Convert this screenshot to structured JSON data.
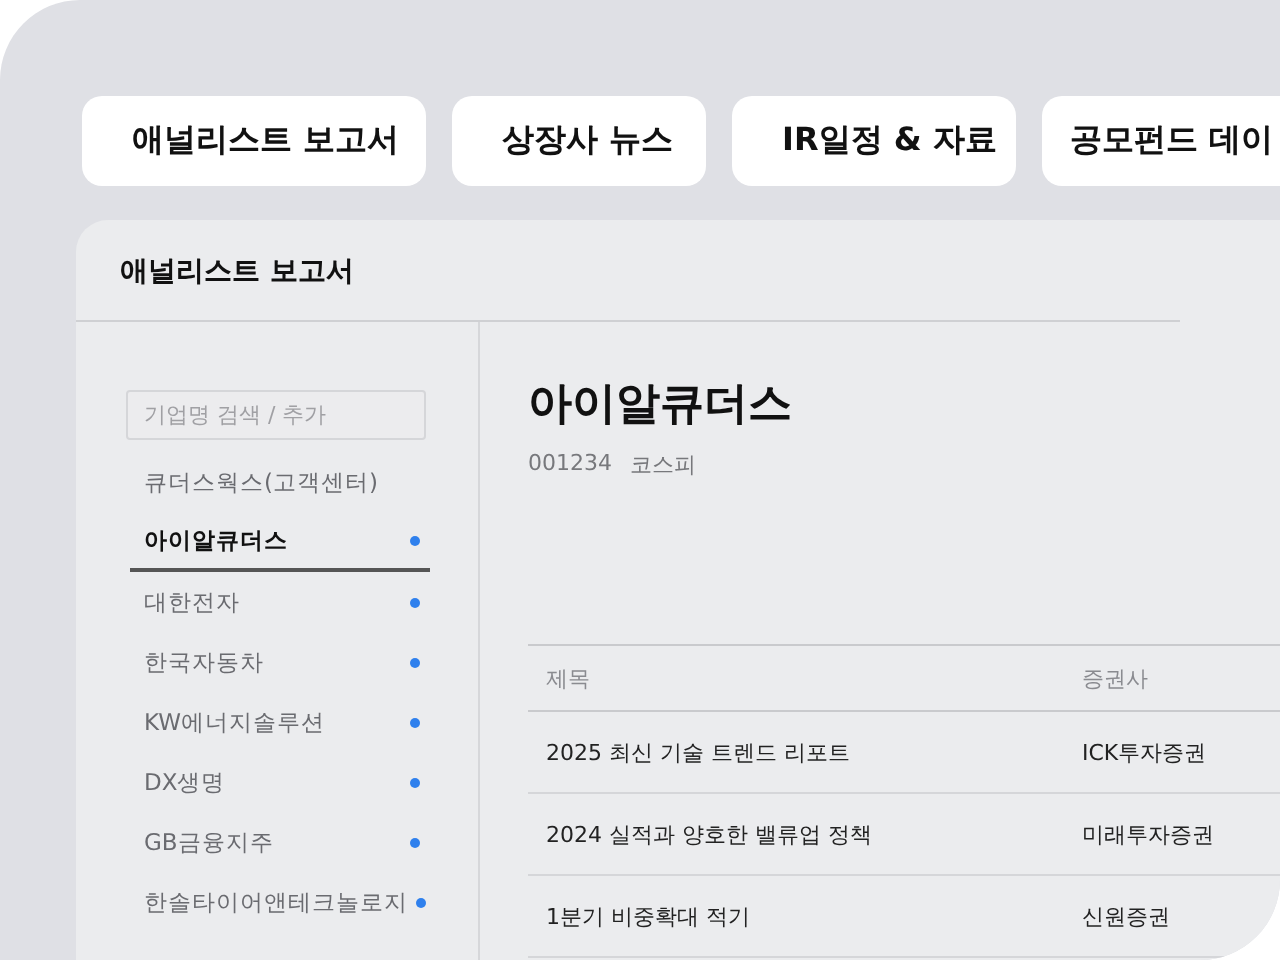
{
  "tabs": [
    {
      "label": "애널리스트 보고서"
    },
    {
      "label": "상장사 뉴스"
    },
    {
      "label": "IR일정 & 자료"
    },
    {
      "label": "공모펀드 데이"
    }
  ],
  "panel": {
    "title": "애널리스트 보고서",
    "sidebar": {
      "search": {
        "placeholder": "기업명 검색 / 추가"
      },
      "items": [
        {
          "label": "큐더스웍스(고객센터)",
          "selected": false,
          "dot": false
        },
        {
          "label": "아이알큐더스",
          "selected": true,
          "dot": true
        },
        {
          "label": "대한전자",
          "selected": false,
          "dot": true
        },
        {
          "label": "한국자동차",
          "selected": false,
          "dot": true
        },
        {
          "label": "KW에너지솔루션",
          "selected": false,
          "dot": true
        },
        {
          "label": "DX생명",
          "selected": false,
          "dot": true
        },
        {
          "label": "GB금융지주",
          "selected": false,
          "dot": true
        },
        {
          "label": "한솔타이어앤테크놀로지",
          "selected": false,
          "dot": true
        }
      ]
    },
    "company": {
      "name": "아이알큐더스",
      "code": "001234",
      "market": "코스피"
    },
    "table": {
      "columns": [
        "제목",
        "증권사"
      ],
      "rows": [
        [
          "2025 최신 기술 트렌드 리포트",
          "ICK투자증권"
        ],
        [
          "2024 실적과 양호한 밸류업 정책",
          "미래투자증권"
        ],
        [
          "1분기 비중확대 적기",
          "신원증권"
        ]
      ]
    }
  }
}
